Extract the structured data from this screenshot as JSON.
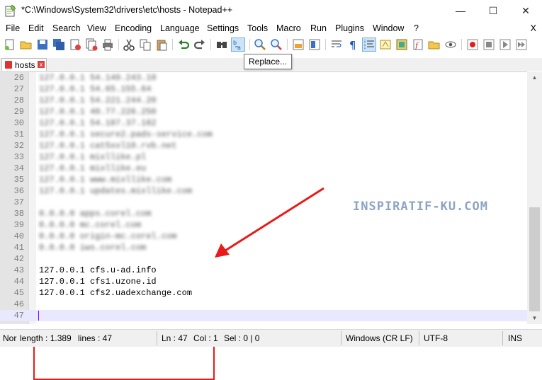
{
  "window": {
    "title": "*C:\\Windows\\System32\\drivers\\etc\\hosts - Notepad++",
    "minimize": "—",
    "maximize": "☐",
    "close": "✕"
  },
  "menu": {
    "items": [
      "File",
      "Edit",
      "Search",
      "View",
      "Encoding",
      "Language",
      "Settings",
      "Tools",
      "Macro",
      "Run",
      "Plugins",
      "Window",
      "?"
    ],
    "close": "X"
  },
  "tooltip": "Replace...",
  "tab": {
    "label": "hosts",
    "close": "x"
  },
  "editor": {
    "lines": [
      {
        "num": "26",
        "text": "127.0.0.1 54.149.243.10"
      },
      {
        "num": "27",
        "text": "127.0.0.1 54.65.155.64"
      },
      {
        "num": "28",
        "text": "127.0.0.1 54.221.244.20"
      },
      {
        "num": "29",
        "text": "127.0.0.1 40.77.226.250"
      },
      {
        "num": "30",
        "text": "127.0.0.1 54.187.37.182"
      },
      {
        "num": "31",
        "text": "127.0.0.1 secure2.pads-service.com"
      },
      {
        "num": "32",
        "text": "127.0.0.1 cat5xxl10.rvb.net"
      },
      {
        "num": "33",
        "text": "127.0.0.1 mixllike.pl"
      },
      {
        "num": "34",
        "text": "127.0.0.1 mixllike.eu"
      },
      {
        "num": "35",
        "text": "127.0.0.1 www.mixllike.com"
      },
      {
        "num": "36",
        "text": "127.0.0.1 updates.mixllike.com"
      },
      {
        "num": "37",
        "text": ""
      },
      {
        "num": "38",
        "text": "0.0.0.0 apps.corel.com"
      },
      {
        "num": "39",
        "text": "0.0.0.0 mc.corel.com"
      },
      {
        "num": "40",
        "text": "0.0.0.0 origin-mc.corel.com"
      },
      {
        "num": "41",
        "text": "0.0.0.0 iws.corel.com"
      },
      {
        "num": "42",
        "text": ""
      },
      {
        "num": "43",
        "text": "127.0.0.1 cfs.u-ad.info"
      },
      {
        "num": "44",
        "text": "127.0.0.1 cfs1.uzone.id"
      },
      {
        "num": "45",
        "text": "127.0.0.1 cfs2.uadexchange.com"
      },
      {
        "num": "46",
        "text": ""
      },
      {
        "num": "47",
        "text": ""
      }
    ]
  },
  "watermark": "INSPIRATIF-KU.COM",
  "status": {
    "type": "Nor",
    "length": "length : 1.389",
    "lines": "lines : 47",
    "ln": "Ln : 47",
    "col": "Col : 1",
    "sel": "Sel : 0 | 0",
    "eol": "Windows (CR LF)",
    "encoding": "UTF-8",
    "mode": "INS"
  },
  "colors": {
    "highlight": "#e81a1a",
    "arrow": "#e81a1a",
    "current_line": "#e8e8ff",
    "caret": "#8000ff"
  }
}
